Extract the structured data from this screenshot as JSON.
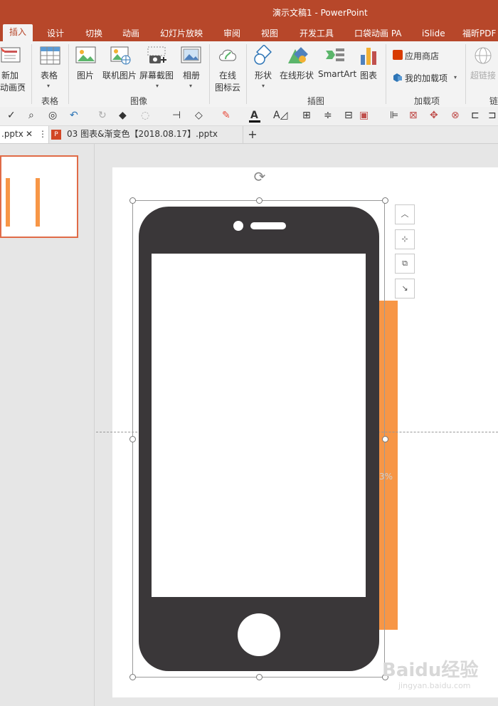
{
  "window_title": "演示文稿1 - PowerPoint",
  "tabs": [
    "插入",
    "设计",
    "切换",
    "动画",
    "幻灯片放映",
    "审阅",
    "视图",
    "开发工具",
    "口袋动画 PA",
    "iSlide",
    "福昕PDF"
  ],
  "ribbon": {
    "new_slide": [
      "新加",
      "动画页"
    ],
    "table": "表格",
    "picture": "图片",
    "online_picture": "联机图片",
    "screenshot": "屏幕截图",
    "album": "相册",
    "online_icon": [
      "在线",
      "图标云"
    ],
    "shape": "形状",
    "online_shape": "在线形状",
    "smartart": "SmartArt",
    "chart": "图表",
    "app_store": "应用商店",
    "my_addins": "我的加载项",
    "hyperlink": "超链接",
    "groups": {
      "table": "表格",
      "image": "图像",
      "illustration": "插图",
      "addins": "加载项",
      "link": "链"
    }
  },
  "doc_tabs": [
    {
      "label": ".pptx"
    },
    {
      "label": "03 图表&渐变色【2018.08.17】.pptx"
    }
  ],
  "slide": {
    "partial_text": "3%"
  },
  "watermark": {
    "main": "Baidu经验",
    "url": "jingyan.baidu.com"
  },
  "colors": {
    "accent": "#b7472a",
    "orange": "#f79646",
    "phone": "#3a3739"
  },
  "icons": [
    "check-icon",
    "zoom-icon",
    "preview-icon",
    "undo-icon",
    "redo-icon",
    "paint-icon",
    "shape-icon",
    "font-color-icon",
    "align-icon",
    "add-tab-icon",
    "ppt-file-icon"
  ]
}
